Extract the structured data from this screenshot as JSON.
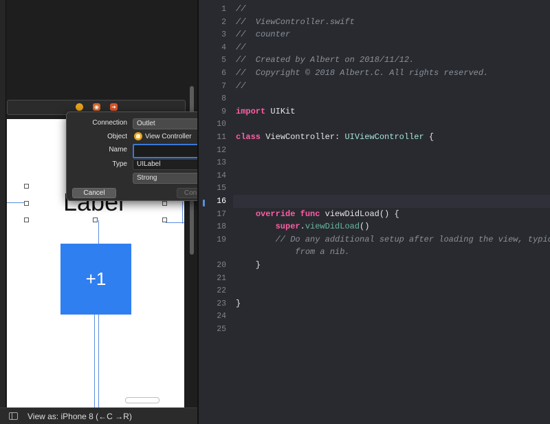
{
  "interface_builder": {
    "canvas_label_text": "Label",
    "button_title": "+1",
    "view_as": "View as: iPhone 8 (←C →R)"
  },
  "connection_popover": {
    "connection_label": "Connection",
    "connection_value": "Outlet",
    "object_label": "Object",
    "object_value": "View Controller",
    "name_label": "Name",
    "name_value": "",
    "type_label": "Type",
    "type_value": "UILabel",
    "storage_value": "Strong",
    "cancel_label": "Cancel",
    "connect_label": "Connect"
  },
  "editor": {
    "current_line": 16,
    "lines": [
      {
        "n": "1",
        "text": "//"
      },
      {
        "n": "2",
        "text": "//  ViewController.swift"
      },
      {
        "n": "3",
        "text": "//  counter"
      },
      {
        "n": "4",
        "text": "//"
      },
      {
        "n": "5",
        "text": "//  Created by Albert on 2018/11/12."
      },
      {
        "n": "6",
        "text": "//  Copyright © 2018 Albert.C. All rights reserved."
      },
      {
        "n": "7",
        "text": "//"
      },
      {
        "n": "8",
        "text": ""
      },
      {
        "n": "9",
        "text": "import UIKit"
      },
      {
        "n": "10",
        "text": ""
      },
      {
        "n": "11",
        "text": "class ViewController: UIViewController {"
      },
      {
        "n": "12",
        "text": ""
      },
      {
        "n": "13",
        "text": ""
      },
      {
        "n": "14",
        "text": ""
      },
      {
        "n": "15",
        "text": ""
      },
      {
        "n": "16",
        "text": ""
      },
      {
        "n": "17",
        "text": "    override func viewDidLoad() {"
      },
      {
        "n": "18",
        "text": "        super.viewDidLoad()"
      },
      {
        "n": "19",
        "text": "        // Do any additional setup after loading the view, typically"
      },
      {
        "n": "",
        "text": "            from a nib."
      },
      {
        "n": "20",
        "text": "    }"
      },
      {
        "n": "21",
        "text": ""
      },
      {
        "n": "22",
        "text": ""
      },
      {
        "n": "23",
        "text": "}"
      },
      {
        "n": "24",
        "text": ""
      },
      {
        "n": "25",
        "text": ""
      }
    ]
  },
  "colors": {
    "editor_background": "#292a30",
    "keyword": "#fc5fa3",
    "comment": "#8a9199",
    "accent_blue": "#2f7ff0"
  }
}
